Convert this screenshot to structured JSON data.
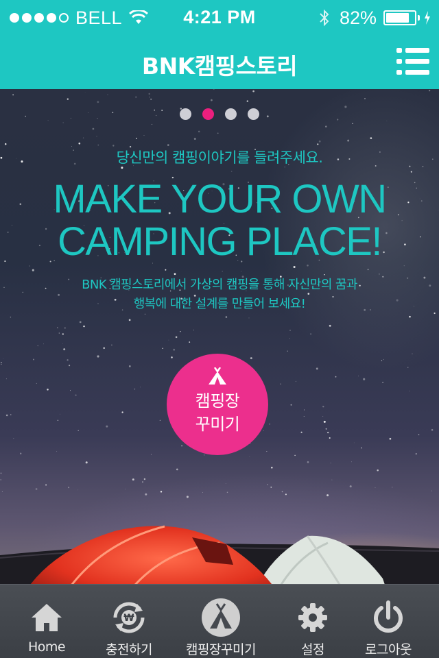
{
  "status_bar": {
    "carrier": "BELL",
    "time": "4:21 PM",
    "battery_percent": "82%",
    "battery_level": 0.82,
    "icons": [
      "signal-dots-icon",
      "wifi-icon",
      "bluetooth-icon",
      "battery-icon",
      "charging-icon"
    ]
  },
  "header": {
    "title": "BNK캠핑스토리",
    "menu_icon": "list-menu-icon"
  },
  "carousel": {
    "page_count": 4,
    "active_page": 2
  },
  "hero": {
    "subtitle": "당신만의 캠핑이야기를 들려주세요.",
    "headline_line1": "MAKE YOUR OWN",
    "headline_line2": "CAMPING PLACE!",
    "description_line1": "BNK 캠핑스토리에서 가상의 캠핑을 통해 자신만의 꿈과",
    "description_line2": "행복에 대한 설계를 만들어 보세요!",
    "cta_line1": "캠핑장",
    "cta_line2": "꾸미기",
    "cta_icon": "tent-icon"
  },
  "colors": {
    "accent": "#1ec7c2",
    "cta": "#ec2f8d",
    "pager_active": "#ec1f7e",
    "tabbar": "#3f4349"
  },
  "tabs": [
    {
      "label": "Home",
      "icon": "home-icon"
    },
    {
      "label": "충전하기",
      "icon": "won-refresh-icon"
    },
    {
      "label": "캠핑장꾸미기",
      "icon": "tent-icon"
    },
    {
      "label": "설정",
      "icon": "gear-icon"
    },
    {
      "label": "로그아웃",
      "icon": "power-icon"
    }
  ]
}
